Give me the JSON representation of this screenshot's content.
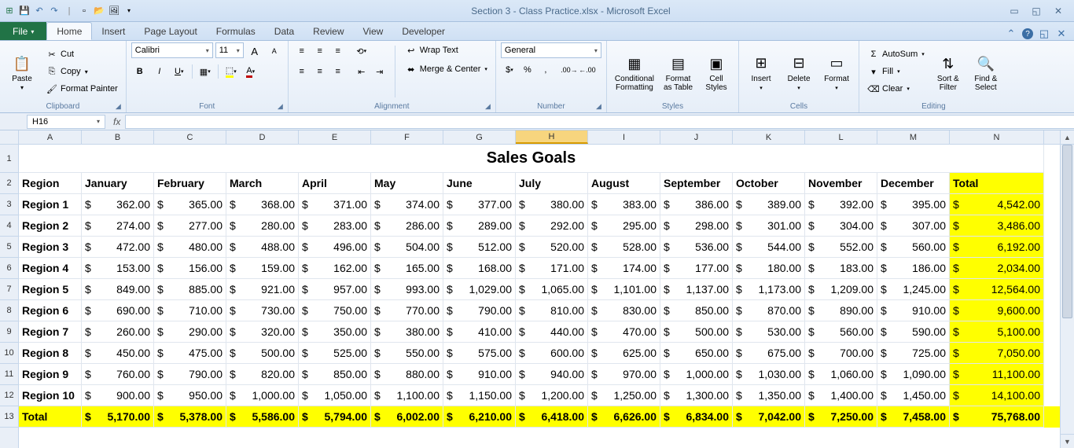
{
  "title": "Section 3 - Class Practice.xlsx - Microsoft Excel",
  "tabs": {
    "file": "File",
    "list": [
      "Home",
      "Insert",
      "Page Layout",
      "Formulas",
      "Data",
      "Review",
      "View",
      "Developer"
    ],
    "active": 0
  },
  "ribbon": {
    "clipboard": {
      "paste": "Paste",
      "cut": "Cut",
      "copy": "Copy",
      "painter": "Format Painter",
      "label": "Clipboard"
    },
    "font": {
      "name": "Calibri",
      "size": "11",
      "label": "Font"
    },
    "alignment": {
      "wrap": "Wrap Text",
      "merge": "Merge & Center",
      "label": "Alignment"
    },
    "number": {
      "format": "General",
      "label": "Number"
    },
    "styles": {
      "cf": "Conditional\nFormatting",
      "fat": "Format\nas Table",
      "cs": "Cell\nStyles",
      "label": "Styles"
    },
    "cells": {
      "ins": "Insert",
      "del": "Delete",
      "fmt": "Format",
      "label": "Cells"
    },
    "editing": {
      "sum": "AutoSum",
      "fill": "Fill",
      "clear": "Clear",
      "sort": "Sort &\nFilter",
      "find": "Find &\nSelect",
      "label": "Editing"
    }
  },
  "namebox": "H16",
  "columns": [
    "A",
    "B",
    "C",
    "D",
    "E",
    "F",
    "G",
    "H",
    "I",
    "J",
    "K",
    "L",
    "M",
    "N"
  ],
  "selectedCol": "H",
  "rows": [
    "1",
    "2",
    "3",
    "4",
    "5",
    "6",
    "7",
    "8",
    "9",
    "10",
    "11",
    "12",
    "13"
  ],
  "sheetTitle": "Sales Goals",
  "headers": [
    "Region",
    "January",
    "February",
    "March",
    "April",
    "May",
    "June",
    "July",
    "August",
    "September",
    "October",
    "November",
    "December",
    "Total"
  ],
  "data": [
    {
      "r": "Region 1",
      "v": [
        "362.00",
        "365.00",
        "368.00",
        "371.00",
        "374.00",
        "377.00",
        "380.00",
        "383.00",
        "386.00",
        "389.00",
        "392.00",
        "395.00"
      ],
      "t": "4,542.00"
    },
    {
      "r": "Region 2",
      "v": [
        "274.00",
        "277.00",
        "280.00",
        "283.00",
        "286.00",
        "289.00",
        "292.00",
        "295.00",
        "298.00",
        "301.00",
        "304.00",
        "307.00"
      ],
      "t": "3,486.00"
    },
    {
      "r": "Region 3",
      "v": [
        "472.00",
        "480.00",
        "488.00",
        "496.00",
        "504.00",
        "512.00",
        "520.00",
        "528.00",
        "536.00",
        "544.00",
        "552.00",
        "560.00"
      ],
      "t": "6,192.00"
    },
    {
      "r": "Region 4",
      "v": [
        "153.00",
        "156.00",
        "159.00",
        "162.00",
        "165.00",
        "168.00",
        "171.00",
        "174.00",
        "177.00",
        "180.00",
        "183.00",
        "186.00"
      ],
      "t": "2,034.00"
    },
    {
      "r": "Region 5",
      "v": [
        "849.00",
        "885.00",
        "921.00",
        "957.00",
        "993.00",
        "1,029.00",
        "1,065.00",
        "1,101.00",
        "1,137.00",
        "1,173.00",
        "1,209.00",
        "1,245.00"
      ],
      "t": "12,564.00"
    },
    {
      "r": "Region 6",
      "v": [
        "690.00",
        "710.00",
        "730.00",
        "750.00",
        "770.00",
        "790.00",
        "810.00",
        "830.00",
        "850.00",
        "870.00",
        "890.00",
        "910.00"
      ],
      "t": "9,600.00"
    },
    {
      "r": "Region 7",
      "v": [
        "260.00",
        "290.00",
        "320.00",
        "350.00",
        "380.00",
        "410.00",
        "440.00",
        "470.00",
        "500.00",
        "530.00",
        "560.00",
        "590.00"
      ],
      "t": "5,100.00"
    },
    {
      "r": "Region 8",
      "v": [
        "450.00",
        "475.00",
        "500.00",
        "525.00",
        "550.00",
        "575.00",
        "600.00",
        "625.00",
        "650.00",
        "675.00",
        "700.00",
        "725.00"
      ],
      "t": "7,050.00"
    },
    {
      "r": "Region 9",
      "v": [
        "760.00",
        "790.00",
        "820.00",
        "850.00",
        "880.00",
        "910.00",
        "940.00",
        "970.00",
        "1,000.00",
        "1,030.00",
        "1,060.00",
        "1,090.00"
      ],
      "t": "11,100.00"
    },
    {
      "r": "Region 10",
      "v": [
        "900.00",
        "950.00",
        "1,000.00",
        "1,050.00",
        "1,100.00",
        "1,150.00",
        "1,200.00",
        "1,250.00",
        "1,300.00",
        "1,350.00",
        "1,400.00",
        "1,450.00"
      ],
      "t": "14,100.00"
    }
  ],
  "totals": {
    "r": "Total",
    "v": [
      "5,170.00",
      "5,378.00",
      "5,586.00",
      "5,794.00",
      "6,002.00",
      "6,210.00",
      "6,418.00",
      "6,626.00",
      "6,834.00",
      "7,042.00",
      "7,250.00",
      "7,458.00"
    ],
    "t": "75,768.00"
  }
}
